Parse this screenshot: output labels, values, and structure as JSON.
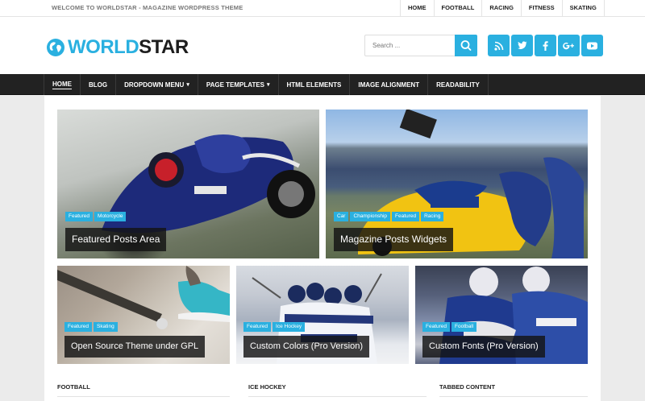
{
  "topbar": {
    "welcome": "WELCOME TO WORLDSTAR - MAGAZINE WORDPRESS THEME",
    "nav": [
      "HOME",
      "FOOTBALL",
      "RACING",
      "FITNESS",
      "SKATING"
    ]
  },
  "header": {
    "brand_part1": "WORLD",
    "brand_part2": "STAR",
    "search_placeholder": "Search ...",
    "social": [
      {
        "icon": "rss-icon",
        "glyph": "⌁"
      },
      {
        "icon": "twitter-icon",
        "glyph": "t"
      },
      {
        "icon": "facebook-icon",
        "glyph": "f"
      },
      {
        "icon": "google-plus-icon",
        "glyph": "G+"
      },
      {
        "icon": "youtube-icon",
        "glyph": "▶"
      }
    ]
  },
  "mainnav": {
    "items": [
      {
        "label": "HOME",
        "active": true,
        "dropdown": false
      },
      {
        "label": "BLOG",
        "active": false,
        "dropdown": false
      },
      {
        "label": "DROPDOWN MENU",
        "active": false,
        "dropdown": true
      },
      {
        "label": "PAGE TEMPLATES",
        "active": false,
        "dropdown": true
      },
      {
        "label": "HTML ELEMENTS",
        "active": false,
        "dropdown": false
      },
      {
        "label": "IMAGE ALIGNMENT",
        "active": false,
        "dropdown": false
      },
      {
        "label": "READABILITY",
        "active": false,
        "dropdown": false
      }
    ]
  },
  "posts": [
    {
      "title": "Featured Posts Area",
      "categories": [
        "Featured",
        "Motorcycle"
      ]
    },
    {
      "title": "Magazine Posts Widgets",
      "categories": [
        "Car",
        "Championship",
        "Featured",
        "Racing"
      ]
    },
    {
      "title": "Open Source Theme under GPL",
      "categories": [
        "Featured",
        "Skating"
      ]
    },
    {
      "title": "Custom Colors (Pro Version)",
      "categories": [
        "Featured",
        "Ice Hockey"
      ]
    },
    {
      "title": "Custom Fonts (Pro Version)",
      "categories": [
        "Featured",
        "Football"
      ]
    }
  ],
  "widgets": [
    "FOOTBALL",
    "ICE HOCKEY",
    "TABBED CONTENT"
  ],
  "colors": {
    "accent": "#2ab0e0",
    "nav_bg": "#222222"
  }
}
